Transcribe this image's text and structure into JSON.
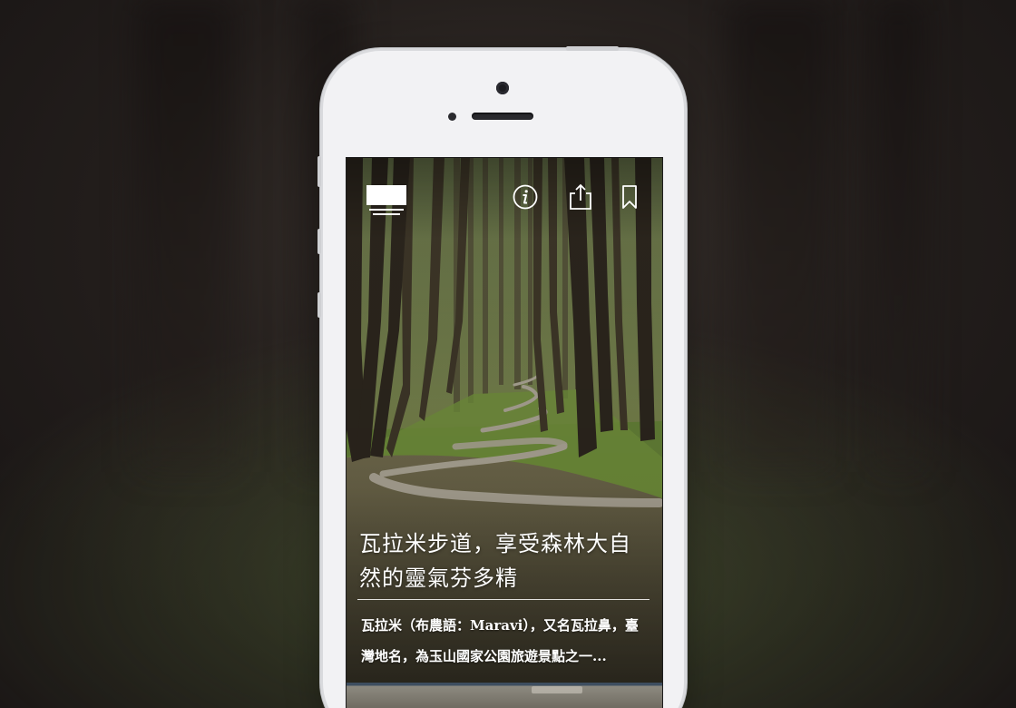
{
  "article": {
    "title": "瓦拉米步道，享受森林大自然的靈氣芬多精",
    "summary": "瓦拉米（布農語：Maravi），又名瓦拉鼻，臺灣地名，為玉山國家公園旅遊景點之一..."
  },
  "toolbar": {
    "icons": [
      "menu-icon",
      "info-icon",
      "share-icon",
      "bookmark-icon"
    ]
  },
  "colors": {
    "background": "#231e1c",
    "phone_body": "#f2f2f4",
    "text": "#ffffff"
  }
}
